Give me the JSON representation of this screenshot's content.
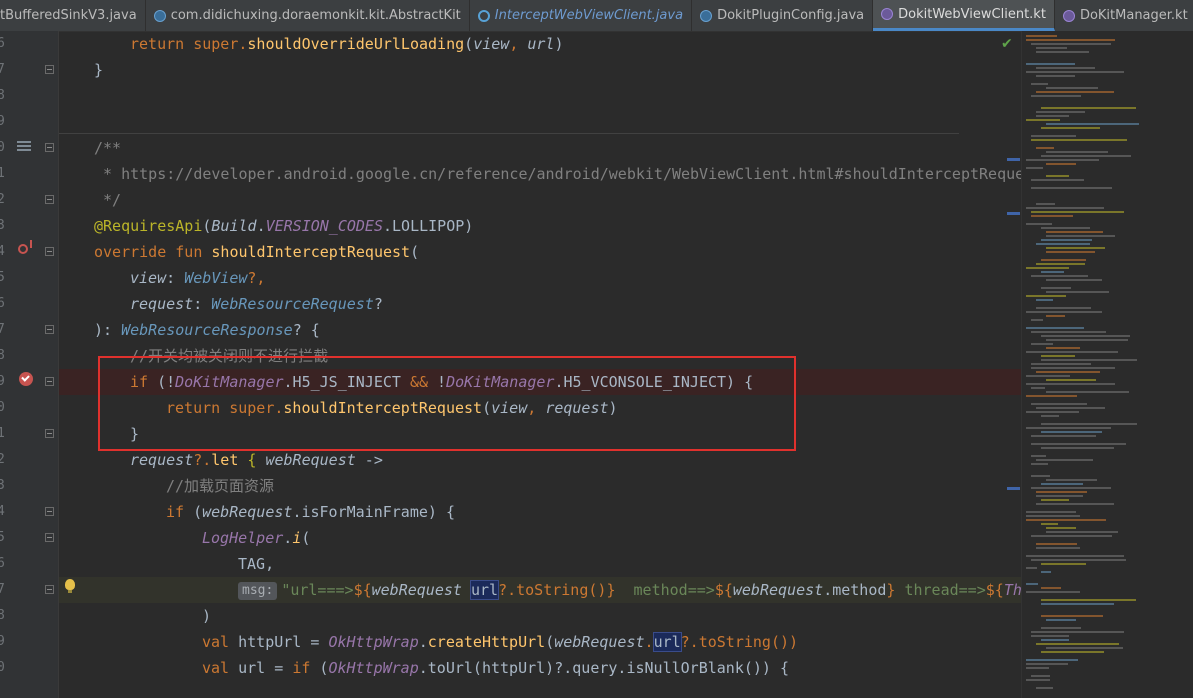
{
  "tabs": [
    {
      "label": "tBufferedSinkV3.java",
      "kind": "java-class",
      "active": false,
      "italic": false
    },
    {
      "label": "com.didichuxing.doraemonkit.kit.AbstractKit",
      "kind": "java-class",
      "active": false,
      "italic": false
    },
    {
      "label": "InterceptWebViewClient.java",
      "kind": "interface",
      "active": false,
      "italic": true
    },
    {
      "label": "DokitPluginConfig.java",
      "kind": "java-class",
      "active": false,
      "italic": false
    },
    {
      "label": "DokitWebViewClient.kt",
      "kind": "kt",
      "active": true,
      "italic": false
    },
    {
      "label": "DoKitManager.kt",
      "kind": "kt",
      "active": false,
      "italic": false
    }
  ],
  "line_numbers": [
    "6",
    "7",
    "8",
    "9",
    "0",
    "1",
    "2",
    "3",
    "4",
    "5",
    "6",
    "7",
    "8",
    "9",
    "0",
    "1",
    "2",
    "3",
    "4",
    "5",
    "6",
    "7",
    "8",
    "9",
    "0"
  ],
  "code": {
    "l1": {
      "a": "return",
      "b": " super.",
      "c": "shouldOverrideUrlLoading",
      "d": "(",
      "e": "view",
      "f": ", ",
      "g": "url",
      "h": ")"
    },
    "l2": {
      "a": "}"
    },
    "l5": {
      "a": "/**"
    },
    "l6": {
      "a": " * https://developer.android.google.cn/reference/android/webkit/WebViewClient.html#shouldInterceptReque"
    },
    "l7": {
      "a": " */"
    },
    "l8": {
      "a": "@RequiresApi",
      "b": "(",
      "c": "Build",
      "d": ".",
      "e": "VERSION_CODES",
      "f": ".LOLLIPOP)"
    },
    "l9": {
      "a": "override fun ",
      "b": "shouldInterceptRequest",
      "c": "("
    },
    "l10": {
      "a": "view",
      "b": ": ",
      "c": "WebView",
      "d": "?,"
    },
    "l11": {
      "a": "request",
      "b": ": ",
      "c": "WebResourceRequest",
      "d": "?"
    },
    "l12": {
      "a": "): ",
      "b": "WebResourceResponse",
      "c": "? {"
    },
    "l13": {
      "a": "//开关均被关闭则不进行拦截"
    },
    "l14": {
      "a": "if",
      "b": " (!",
      "c": "DoKitManager",
      "d": ".H5_JS_INJECT ",
      "e": "&&",
      "f": " !",
      "g": "DoKitManager",
      "h": ".H5_VCONSOLE_INJECT) {"
    },
    "l15": {
      "a": "return",
      "b": " super.",
      "c": "shouldInterceptRequest",
      "d": "(",
      "e": "view",
      "f": ", ",
      "g": "request",
      "h": ")"
    },
    "l16": {
      "a": "}"
    },
    "l17": {
      "a": "request",
      "b": "?.",
      "c": "let",
      "d": " { ",
      "e": "webRequest",
      "f": " ->"
    },
    "l18": {
      "a": "//加载页面资源"
    },
    "l19": {
      "a": "if",
      "b": " (",
      "c": "webRequest",
      "d": ".isForMainFrame) {"
    },
    "l20": {
      "a": "LogHelper",
      "b": ".",
      "c": "i",
      "d": "("
    },
    "l21": {
      "a": "TAG,"
    },
    "l22": {
      "hint": "msg:",
      "a": "\"url===>",
      "b": "${",
      "c": "webRequest",
      "d": " ",
      "e": "url",
      "f": "?.toString()",
      "g": "}",
      "h": "  method==>",
      "i": "${",
      "j": "webRequest",
      "k": ".method",
      "l": "}",
      "m": " thread==>",
      "n": "${",
      "o": "Th"
    },
    "l23": {
      "a": ")"
    },
    "l24": {
      "a": "val",
      "b": " httpUrl = ",
      "c": "OkHttpWrap",
      "d": ".",
      "e": "createHttpUrl",
      "f": "(",
      "g": "webRequest",
      "h": ".",
      "i": "url",
      "j": "?.toString())"
    },
    "l25": {
      "a": "val",
      "b": " url = ",
      "c": "if",
      "d": " (",
      "e": "OkHttpWrap",
      "f": ".toUrl(httpUrl)?.query.isNullOrBlank()) {"
    }
  },
  "colors": {
    "accent": "#4a88c7",
    "highlight_box": "#e0312d",
    "breakpoint": "#c75450"
  },
  "icons": [
    "java-class-icon",
    "interface-icon",
    "kotlin-file-icon",
    "breakpoint-icon",
    "lightbulb-icon",
    "override-icon",
    "doc-comment-icon",
    "check-icon",
    "fold-icon"
  ]
}
